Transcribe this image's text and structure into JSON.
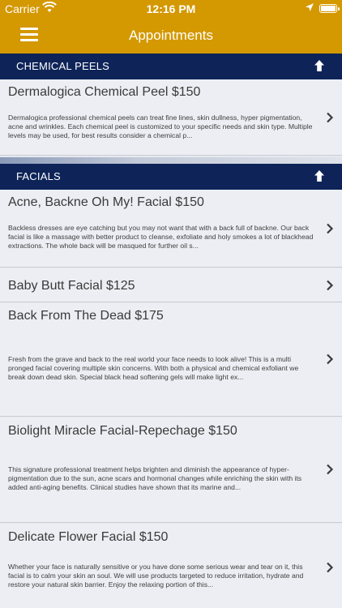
{
  "status_bar": {
    "carrier": "Carrier",
    "time": "12:16 PM"
  },
  "nav": {
    "title": "Appointments"
  },
  "sections": [
    {
      "label": "CHEMICAL PEELS",
      "items": [
        {
          "title": "Dermalogica Chemical Peel $150",
          "description": "Dermalogica professional chemical peels can treat fine lines, skin dullness, hyper pigmentation, acne and wrinkles. Each chemical peel is customized to your specific needs and skin type. Multiple levels may be used, for best results consider a chemical p..."
        }
      ]
    },
    {
      "label": "FACIALS",
      "items": [
        {
          "title": "Acne, Backne Oh My! Facial $150",
          "description": "Backless dresses are eye catching but you may not want that with a back full of backne. Our back facial is like a massage with better product to cleanse, exfoliate and holy smokes a lot of blackhead extractions. The whole back will be masqued for further oil s..."
        },
        {
          "title": "Baby Butt Facial $125",
          "description": ""
        },
        {
          "title": "Back From The Dead $175",
          "description": "Fresh from the grave and back to the real world your face needs to look alive! This is a multi pronged facial covering multiple skin concerns. With both a physical and chemical exfoliant we break down dead skin. Special black head softening gels will make light ex..."
        },
        {
          "title": "Biolight Miracle Facial-Repechage $150",
          "description": "This signature professional treatment helps brighten and diminish the appearance of hyper-pigmentation due to the sun, acne scars and hormonal changes while enriching the skin with its added anti-aging benefits. Clinical studies have shown that its marine and..."
        },
        {
          "title": "Delicate Flower Facial $150",
          "description": "Whether your face is naturally sensitive or you have done some serious wear and tear on it, this facial is to calm your skin an soul. We will use products targeted to reduce irritation, hydrate and restore your natural skin barrier. Enjoy the relaxing portion of this..."
        }
      ]
    }
  ],
  "icons": {
    "menu": "hamburger-menu-icon",
    "collapse": "arrow-up-icon",
    "disclosure": "chevron-right-icon"
  },
  "colors": {
    "nav_bar": "#d49800",
    "section_header": "#0e2459",
    "row_background": "#eceef3"
  }
}
